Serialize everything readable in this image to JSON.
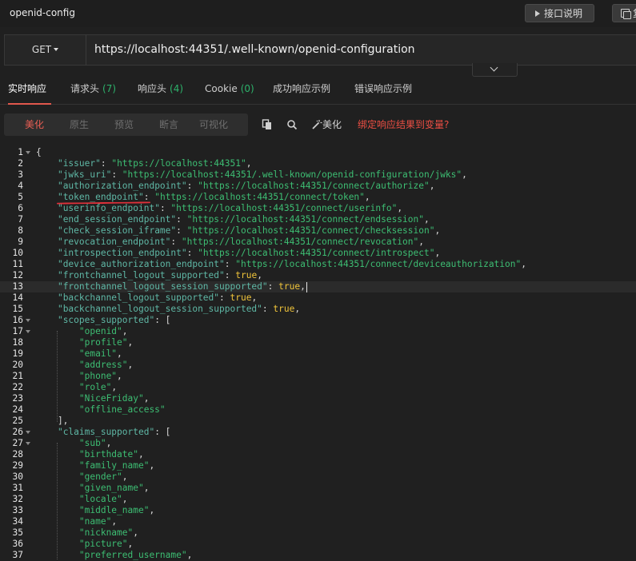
{
  "window": {
    "title": "openid-config",
    "doc_button": "接口说明",
    "copy_button": "复"
  },
  "request": {
    "method": "GET",
    "url": "https://localhost:44351/.well-known/openid-configuration"
  },
  "tabs": [
    {
      "label": "实时响应",
      "count": ""
    },
    {
      "label": "请求头",
      "count": "(7)"
    },
    {
      "label": "响应头",
      "count": "(4)"
    },
    {
      "label": "Cookie",
      "count": "(0)"
    },
    {
      "label": "成功响应示例",
      "count": ""
    },
    {
      "label": "错误响应示例",
      "count": ""
    }
  ],
  "view_modes": [
    "美化",
    "原生",
    "预览",
    "断言",
    "可视化"
  ],
  "tools": {
    "beautify_label": "美化",
    "bind_variable": "绑定响应结果到变量?"
  },
  "code": {
    "lines": [
      "{",
      "    \"issuer\": \"https://localhost:44351\",",
      "    \"jwks_uri\": \"https://localhost:44351/.well-known/openid-configuration/jwks\",",
      "    \"authorization_endpoint\": \"https://localhost:44351/connect/authorize\",",
      "    \"token_endpoint\": \"https://localhost:44351/connect/token\",",
      "    \"userinfo_endpoint\": \"https://localhost:44351/connect/userinfo\",",
      "    \"end_session_endpoint\": \"https://localhost:44351/connect/endsession\",",
      "    \"check_session_iframe\": \"https://localhost:44351/connect/checksession\",",
      "    \"revocation_endpoint\": \"https://localhost:44351/connect/revocation\",",
      "    \"introspection_endpoint\": \"https://localhost:44351/connect/introspect\",",
      "    \"device_authorization_endpoint\": \"https://localhost:44351/connect/deviceauthorization\",",
      "    \"frontchannel_logout_supported\": true,",
      "    \"frontchannel_logout_session_supported\": true,",
      "    \"backchannel_logout_supported\": true,",
      "    \"backchannel_logout_session_supported\": true,",
      "    \"scopes_supported\": [",
      "        \"openid\",",
      "        \"profile\",",
      "        \"email\",",
      "        \"address\",",
      "        \"phone\",",
      "        \"role\",",
      "        \"NiceFriday\",",
      "        \"offline_access\"",
      "    ],",
      "    \"claims_supported\": [",
      "        \"sub\",",
      "        \"birthdate\",",
      "        \"family_name\",",
      "        \"gender\",",
      "        \"given_name\",",
      "        \"locale\",",
      "        \"middle_name\",",
      "        \"name\",",
      "        \"nickname\",",
      "        \"picture\",",
      "        \"preferred_username\","
    ],
    "fold_lines": [
      1,
      16,
      17,
      26,
      27
    ]
  }
}
